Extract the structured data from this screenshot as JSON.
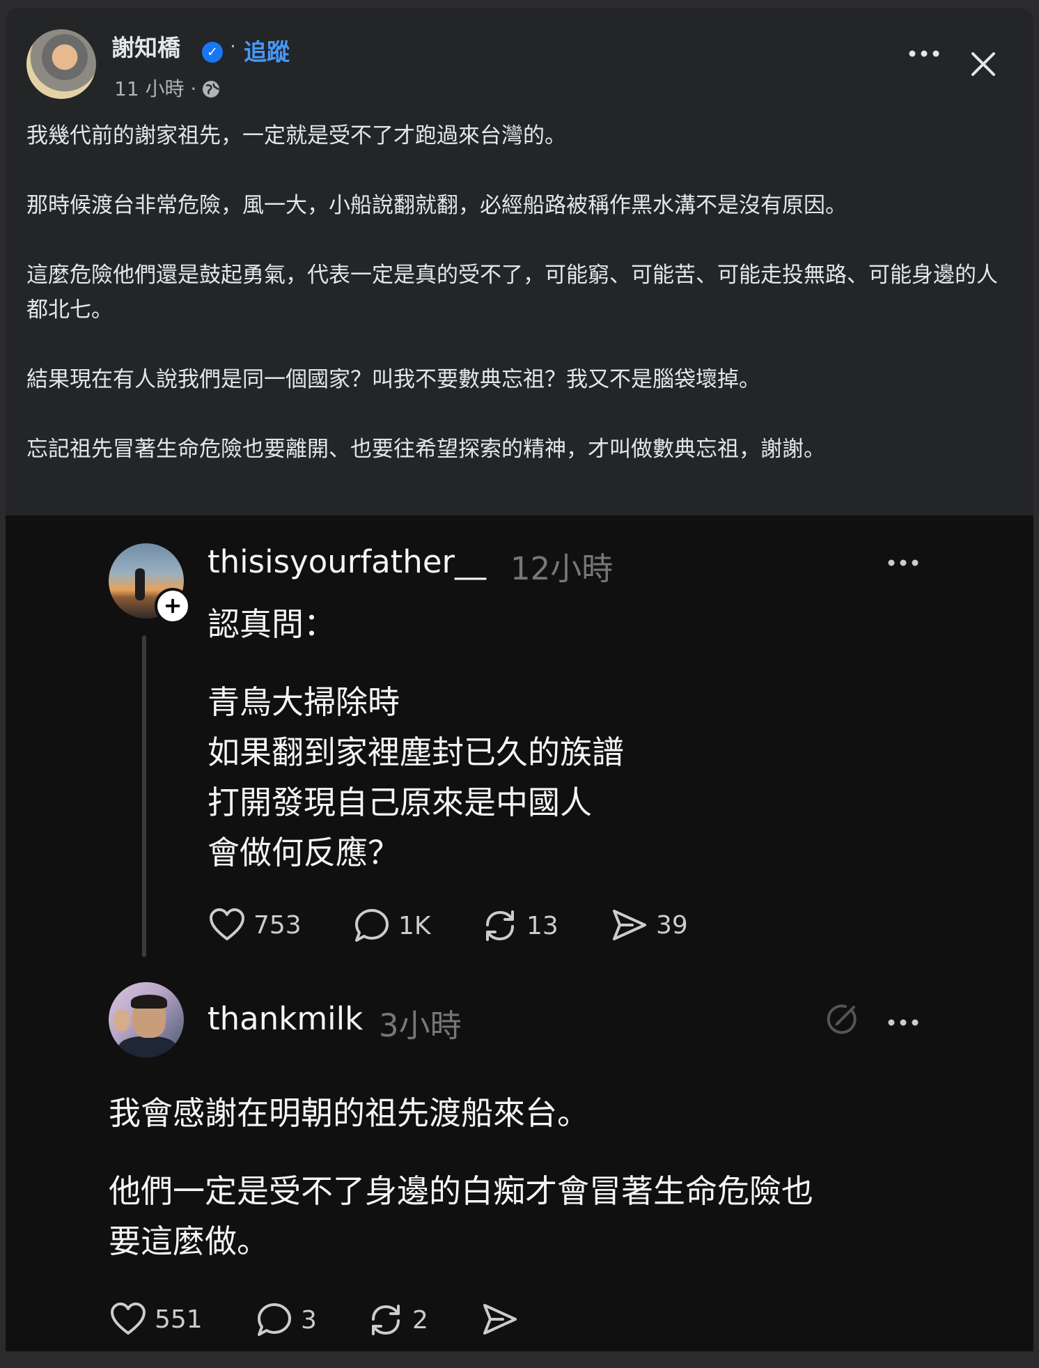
{
  "post": {
    "author": "謝知橋",
    "verified_icon": "verified-badge-icon",
    "separator": "·",
    "follow_label": "追蹤",
    "time": "11 小時 ·",
    "privacy_icon": "globe-icon",
    "paragraphs": [
      "我幾代前的謝家祖先，一定就是受不了才跑過來台灣的。",
      "那時候渡台非常危險，風一大，小船說翻就翻，必經船路被稱作黑水溝不是沒有原因。",
      "這麼危險他們還是鼓起勇氣，代表一定是真的受不了，可能窮、可能苦、可能走投無路、可能身邊的人都北七。",
      "結果現在有人說我們是同一個國家？叫我不要數典忘祖？我又不是腦袋壞掉。",
      "忘記祖先冒著生命危險也要離開、也要往希望探索的精神，才叫做數典忘祖，謝謝。"
    ]
  },
  "thread": {
    "comment1": {
      "username": "thisisyourfather__",
      "time": "12小時",
      "lines": [
        "認真問：",
        "",
        "青鳥大掃除時",
        "如果翻到家裡塵封已久的族譜",
        "打開發現自己原來是中國人",
        "會做何反應？"
      ],
      "likes": "753",
      "replies": "1K",
      "reposts": "13",
      "shares": "39"
    },
    "comment2": {
      "username": "thankmilk",
      "time": "3小時",
      "lines": [
        "我會感謝在明朝的祖先渡船來台。",
        "",
        "他們一定是受不了身邊的白痴才會冒著生命危險也",
        "要這麼做。"
      ],
      "likes": "551",
      "replies": "3",
      "reposts": "2",
      "shares": ""
    }
  },
  "colors": {
    "fb_background": "#242526",
    "threads_background": "#101010",
    "link_blue": "#4599ff",
    "verified_blue": "#1877f2"
  }
}
